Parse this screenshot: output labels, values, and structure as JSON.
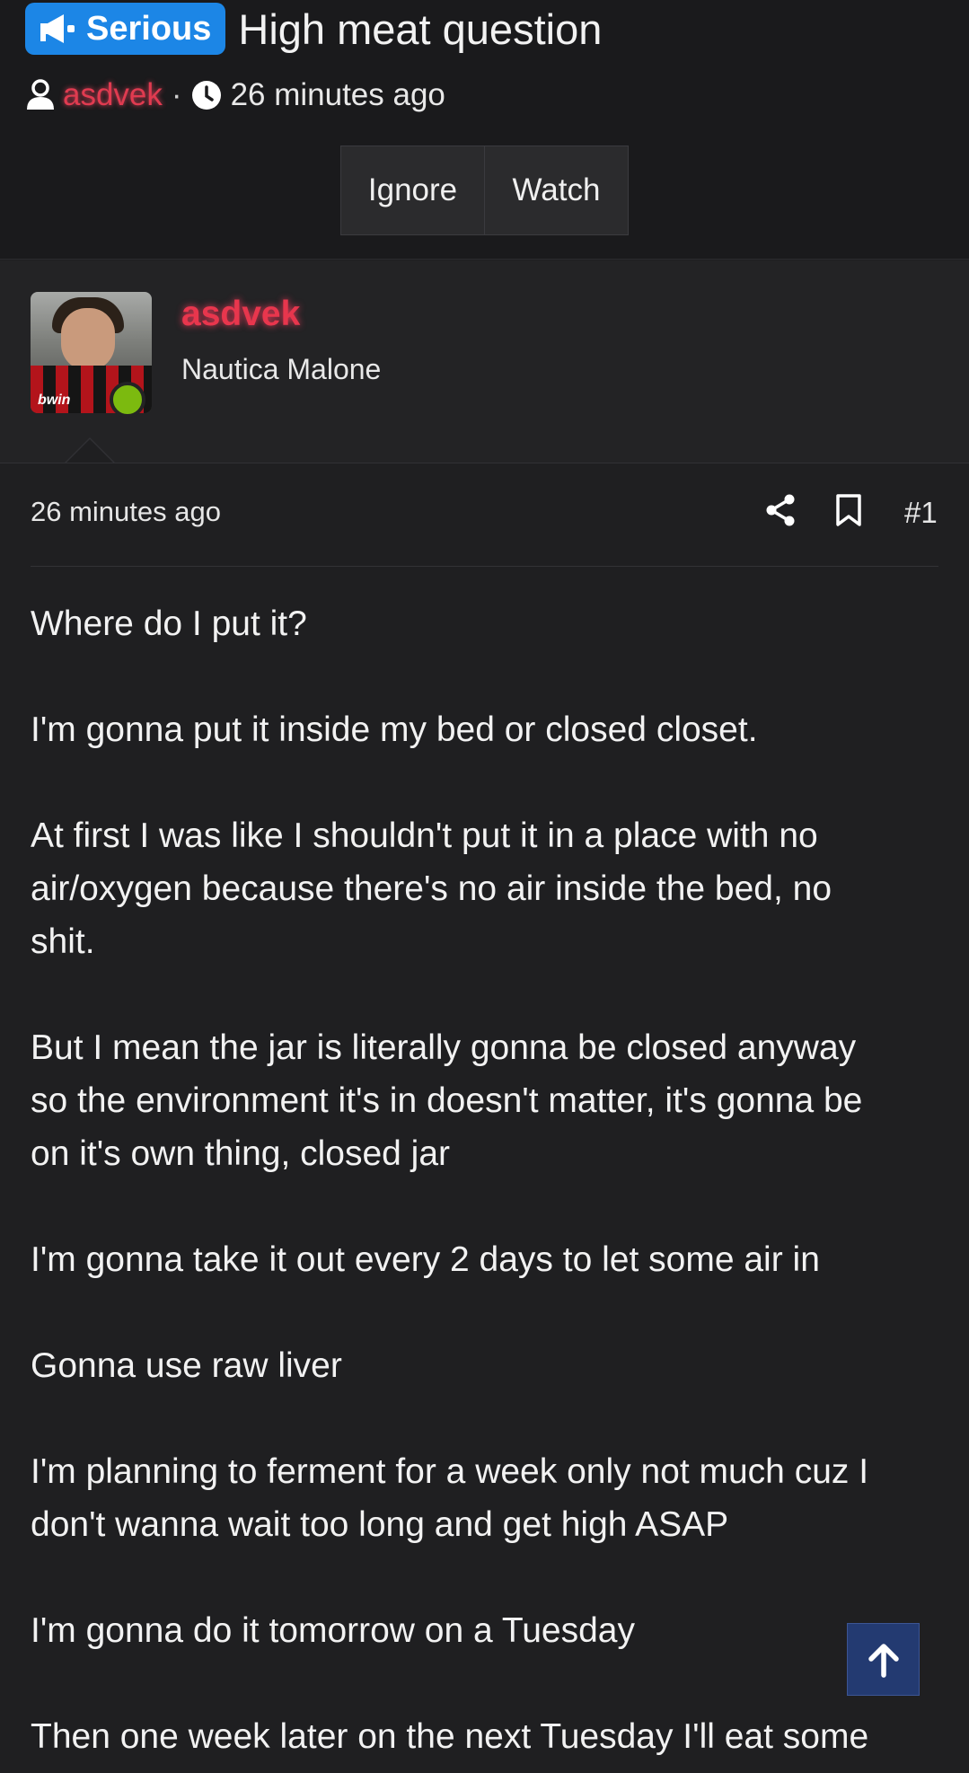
{
  "thread": {
    "prefix": "Serious",
    "title": "High meat question",
    "author": "asdvek",
    "separator": "·",
    "time": "26 minutes ago",
    "buttons": {
      "ignore": "Ignore",
      "watch": "Watch"
    }
  },
  "author_block": {
    "name": "asdvek",
    "user_title": "Nautica Malone",
    "avatar_caption": "bwin",
    "online": true
  },
  "post": {
    "time": "26 minutes ago",
    "number": "#1",
    "paragraphs": [
      [
        "Where do I put it?"
      ],
      [
        "I'm gonna put it inside my bed or closed closet."
      ],
      [
        "At first I was like I shouldn't put it in a place with no",
        "air/oxygen because there's no air inside the bed, no",
        "shit."
      ],
      [
        "But I mean the jar is literally gonna be closed anyway",
        "so the environment it's in doesn't matter, it's gonna be",
        "on it's own thing, closed jar"
      ],
      [
        "I'm gonna take it out every 2 days to let some air in"
      ],
      [
        "Gonna use raw liver"
      ],
      [
        "I'm planning to ferment for a week only not much cuz I",
        "don't wanna wait too long and get high ASAP"
      ],
      [
        "I'm gonna do it tomorrow on a Tuesday"
      ],
      [
        "Then one week later on the next Tuesday I'll eat some"
      ]
    ]
  },
  "icons": {
    "prefix": "megaphone-icon",
    "user": "user-icon",
    "clock": "clock-icon",
    "share": "share-icon",
    "bookmark": "bookmark-icon",
    "scroll_top": "arrow-up-icon"
  },
  "colors": {
    "background": "#1f1f21",
    "prefix_badge": "#1c86e6",
    "username": "#e8364d",
    "online": "#7cba0f",
    "scroll_button": "#233a71"
  }
}
